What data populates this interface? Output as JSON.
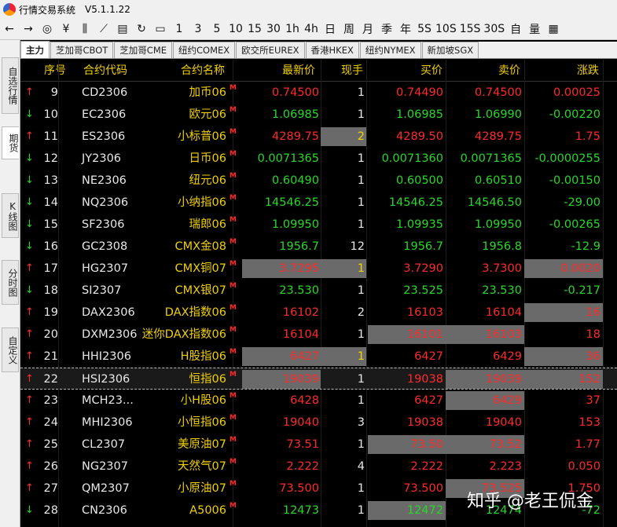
{
  "app": {
    "title": "行情交易系统",
    "version": "V5.1.1.22"
  },
  "toolbar": {
    "icons": [
      "back-arrow-icon",
      "forward-arrow-icon",
      "radar-icon",
      "stock-icon",
      "kline-icon",
      "line-chart-icon",
      "tick-list-icon",
      "refresh-icon",
      "panel-icon"
    ],
    "periods": [
      "1",
      "3",
      "5",
      "10",
      "15",
      "30",
      "1h",
      "4h",
      "日",
      "周",
      "月",
      "季",
      "年",
      "5S",
      "10S",
      "15S",
      "30S",
      "自",
      "量"
    ],
    "trailing_icon": "grid-icon"
  },
  "tabs": [
    "主力",
    "芝加哥CBOT",
    "芝加哥CME",
    "纽约COMEX",
    "欧交所EUREX",
    "香港HKEX",
    "纽约NYMEX",
    "新加坡SGX"
  ],
  "sidebar": [
    {
      "label": "自选行情"
    },
    {
      "label": "期货"
    },
    {
      "label": "K线图"
    },
    {
      "label": "分时图"
    },
    {
      "label": "自定义"
    }
  ],
  "columns": {
    "seq": "序号",
    "code": "合约代码",
    "name": "合约名称",
    "last": "最新价",
    "vol": "现手",
    "bid": "买价",
    "ask": "卖价",
    "change": "涨跌"
  },
  "market_tag": "M",
  "rows": [
    {
      "dir": "up",
      "seq": "9",
      "code": "CD2306",
      "name": "加币06",
      "last": "0.74500",
      "vol": "1",
      "bid": "0.74490",
      "ask": "0.74500",
      "change": "0.00025"
    },
    {
      "dir": "down",
      "seq": "10",
      "code": "EC2306",
      "name": "欧元06",
      "last": "1.06985",
      "vol": "1",
      "bid": "1.06985",
      "ask": "1.06990",
      "change": "-0.00220"
    },
    {
      "dir": "up",
      "seq": "11",
      "code": "ES2306",
      "name": "小标普06",
      "last": "4289.75",
      "vol": "2",
      "bid": "4289.50",
      "ask": "4289.75",
      "change": "1.75"
    },
    {
      "dir": "down",
      "seq": "12",
      "code": "JY2306",
      "name": "日币06",
      "last": "0.0071365",
      "vol": "1",
      "bid": "0.0071360",
      "ask": "0.0071365",
      "change": "-0.0000255"
    },
    {
      "dir": "down",
      "seq": "13",
      "code": "NE2306",
      "name": "纽元06",
      "last": "0.60490",
      "vol": "1",
      "bid": "0.60500",
      "ask": "0.60510",
      "change": "-0.00150"
    },
    {
      "dir": "down",
      "seq": "14",
      "code": "NQ2306",
      "name": "小纳指06",
      "last": "14546.25",
      "vol": "1",
      "bid": "14546.25",
      "ask": "14546.50",
      "change": "-29.00"
    },
    {
      "dir": "down",
      "seq": "15",
      "code": "SF2306",
      "name": "瑞郎06",
      "last": "1.09950",
      "vol": "1",
      "bid": "1.09935",
      "ask": "1.09950",
      "change": "-0.00265"
    },
    {
      "dir": "down",
      "seq": "16",
      "code": "GC2308",
      "name": "CMX金08",
      "last": "1956.7",
      "vol": "12",
      "bid": "1956.7",
      "ask": "1956.8",
      "change": "-12.9"
    },
    {
      "dir": "up",
      "seq": "17",
      "code": "HG2307",
      "name": "CMX铜07",
      "last": "3.7295",
      "vol": "1",
      "bid": "3.7290",
      "ask": "3.7300",
      "change": "0.0020"
    },
    {
      "dir": "down",
      "seq": "18",
      "code": "SI2307",
      "name": "CMX银07",
      "last": "23.530",
      "vol": "1",
      "bid": "23.525",
      "ask": "23.530",
      "change": "-0.217"
    },
    {
      "dir": "up",
      "seq": "19",
      "code": "DAX2306",
      "name": "DAX指数06",
      "last": "16102",
      "vol": "2",
      "bid": "16103",
      "ask": "16104",
      "change": "16"
    },
    {
      "dir": "up",
      "seq": "20",
      "code": "DXM2306",
      "name": "迷你DAX指数06",
      "last": "16104",
      "vol": "1",
      "bid": "16101",
      "ask": "16103",
      "change": "18"
    },
    {
      "dir": "up",
      "seq": "21",
      "code": "HHI2306",
      "name": "H股指06",
      "last": "6427",
      "vol": "1",
      "bid": "6427",
      "ask": "6429",
      "change": "36"
    },
    {
      "dir": "up",
      "seq": "22",
      "code": "HSI2306",
      "name": "恒指06",
      "last": "19039",
      "vol": "1",
      "bid": "19038",
      "ask": "19039",
      "change": "152"
    },
    {
      "dir": "up",
      "seq": "23",
      "code": "MCH23...",
      "name": "小H股06",
      "last": "6428",
      "vol": "1",
      "bid": "6427",
      "ask": "6429",
      "change": "37"
    },
    {
      "dir": "up",
      "seq": "24",
      "code": "MHI2306",
      "name": "小恒指06",
      "last": "19040",
      "vol": "3",
      "bid": "19038",
      "ask": "19040",
      "change": "153"
    },
    {
      "dir": "up",
      "seq": "25",
      "code": "CL2307",
      "name": "美原油07",
      "last": "73.51",
      "vol": "1",
      "bid": "73.50",
      "ask": "73.52",
      "change": "1.77"
    },
    {
      "dir": "up",
      "seq": "26",
      "code": "NG2307",
      "name": "天然气07",
      "last": "2.222",
      "vol": "4",
      "bid": "2.222",
      "ask": "2.223",
      "change": "0.050"
    },
    {
      "dir": "up",
      "seq": "27",
      "code": "QM2307",
      "name": "小原油07",
      "last": "73.500",
      "vol": "1",
      "bid": "73.500",
      "ask": "73.525",
      "change": "1.750"
    },
    {
      "dir": "down",
      "seq": "28",
      "code": "CN2306",
      "name": "A5006",
      "last": "12473",
      "vol": "1",
      "bid": "12472",
      "ask": "12474",
      "change": "-72"
    }
  ],
  "highlights": {
    "11": [
      "vol"
    ],
    "17": [
      "last",
      "vol",
      "change"
    ],
    "19": [
      "change"
    ],
    "20": [
      "bid",
      "ask"
    ],
    "21": [
      "last",
      "vol",
      "change"
    ],
    "22": [
      "last",
      "ask",
      "change"
    ],
    "23": [
      "ask"
    ],
    "25": [
      "bid",
      "ask"
    ],
    "27": [
      "ask"
    ],
    "28": [
      "bid"
    ]
  },
  "selected_seq": "22",
  "watermark": "知乎 @老王侃金",
  "colors": {
    "up": "#ff2a2a",
    "down": "#28d828",
    "header": "#f0d000",
    "highlight": "#6a6a6a"
  }
}
